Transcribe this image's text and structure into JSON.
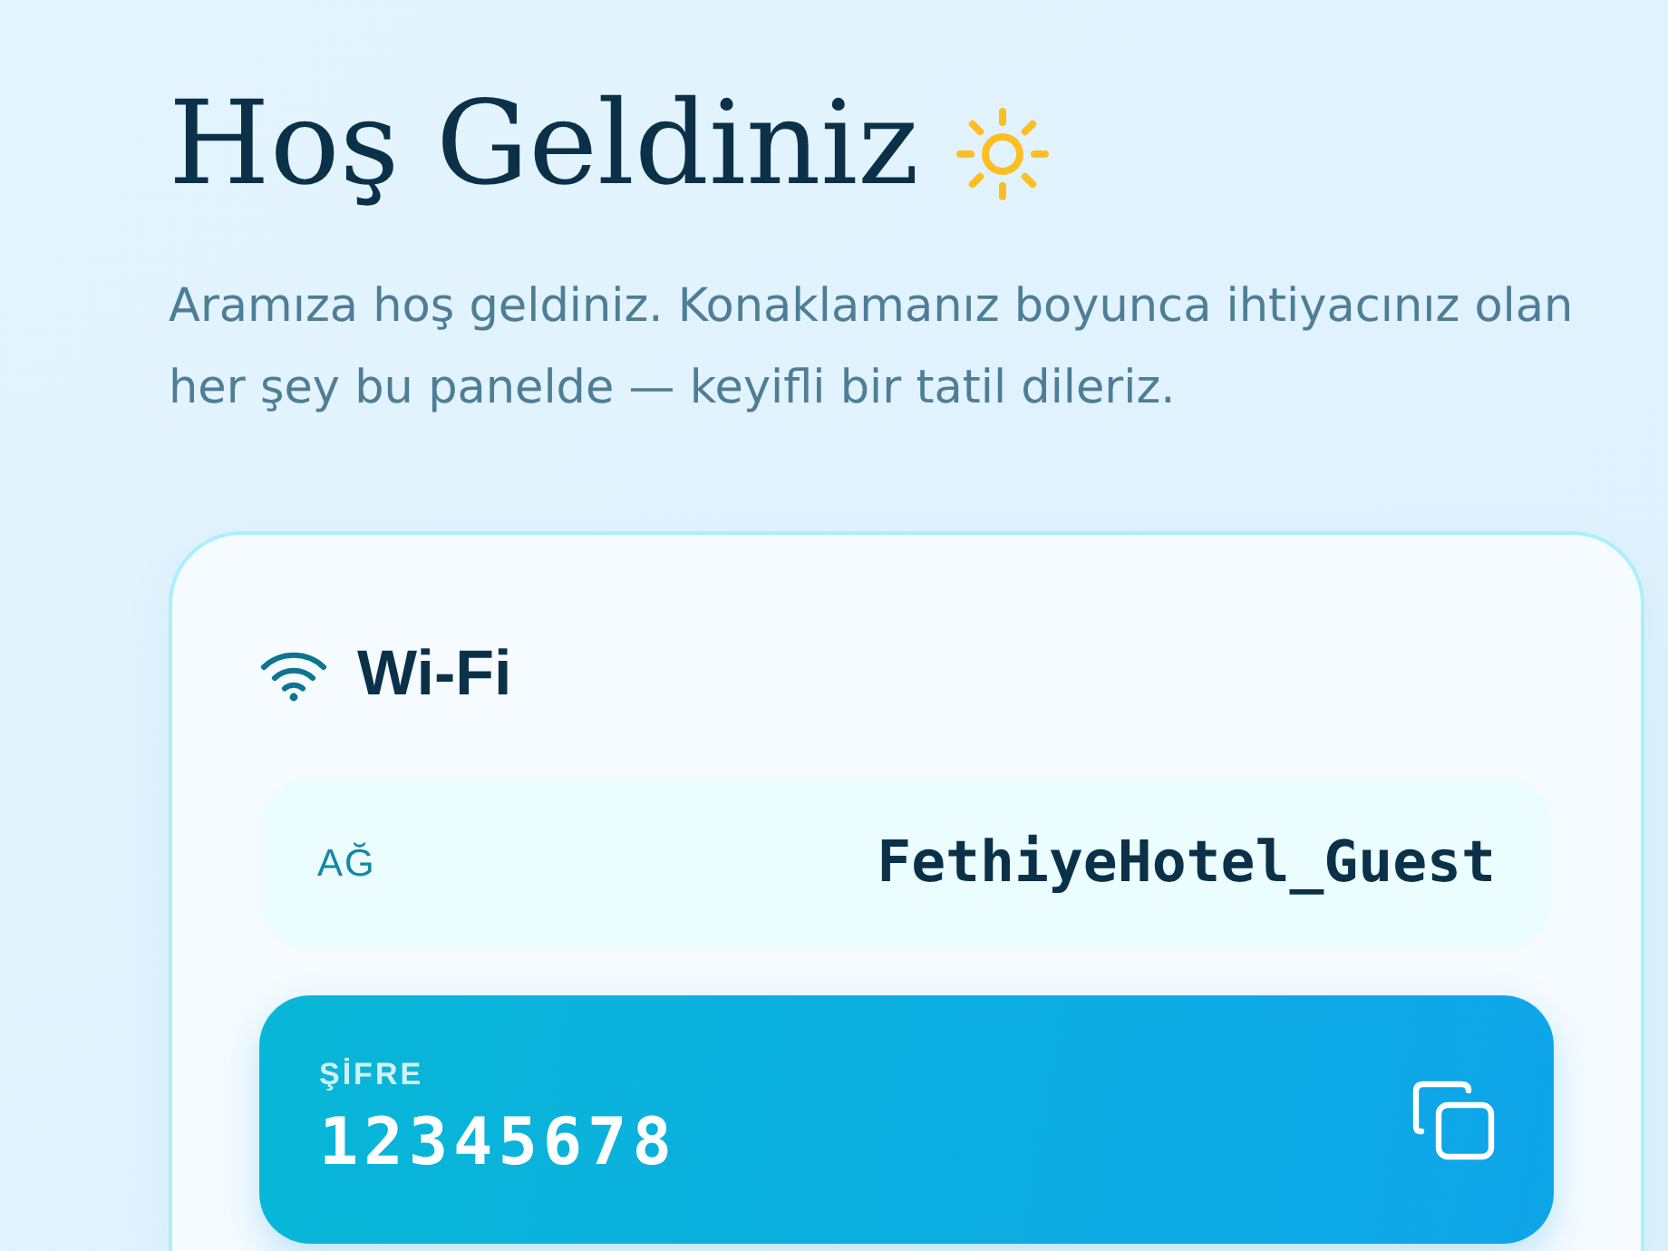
{
  "header": {
    "title": "Hoş Geldiniz",
    "subtitle": "Aramıza hoş geldiniz. Konaklamanız boyunca ihtiyacınız olan her şey bu panelde — keyifli bir tatil dileriz."
  },
  "wifi_card": {
    "title": "Wi-Fi",
    "fields": [
      {
        "kind": "plain",
        "label": "AĞ",
        "value": "FethiyeHotel_Guest"
      },
      {
        "kind": "highlight",
        "label": "ŞİFRE",
        "value": "12345678"
      }
    ]
  }
}
